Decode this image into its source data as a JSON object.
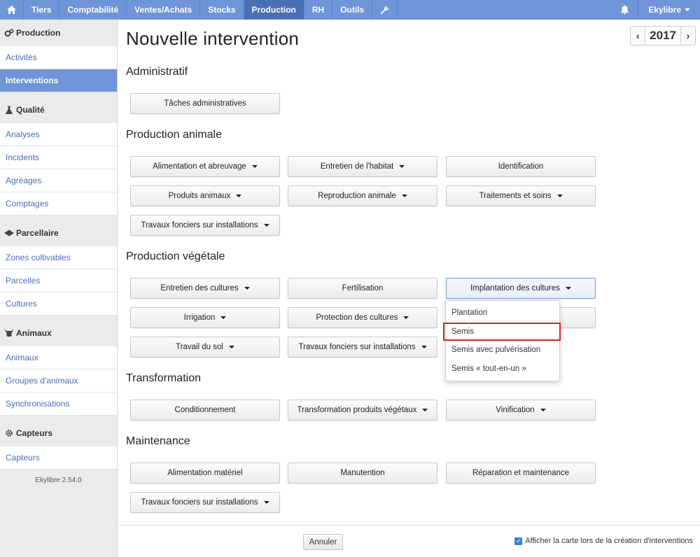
{
  "topbar": {
    "home_icon": "home-icon",
    "items": [
      {
        "label": "Tiers"
      },
      {
        "label": "Comptabilité"
      },
      {
        "label": "Ventes/Achats"
      },
      {
        "label": "Stocks"
      },
      {
        "label": "Production"
      },
      {
        "label": "RH"
      },
      {
        "label": "Outils"
      }
    ],
    "settings_icon": "wrench-icon",
    "notification_icon": "bell-icon",
    "user": "Ekylibre",
    "accent": "#6f94d8",
    "active_accent": "#4a6fb5"
  },
  "sidebar": {
    "sections": [
      {
        "title": "Production",
        "icon": "gears-icon",
        "items": [
          "Activités",
          "Interventions"
        ]
      },
      {
        "title": "Qualité",
        "icon": "flask-icon",
        "items": [
          "Analyses",
          "Incidents",
          "Agréages",
          "Comptages"
        ]
      },
      {
        "title": "Parcellaire",
        "icon": "map-icon",
        "items": [
          "Zones cultivables",
          "Parcelles",
          "Cultures"
        ]
      },
      {
        "title": "Animaux",
        "icon": "cow-icon",
        "items": [
          "Animaux",
          "Groupes d'animaux",
          "Synchronisations"
        ]
      },
      {
        "title": "Capteurs",
        "icon": "gear-icon",
        "items": [
          "Capteurs"
        ]
      }
    ],
    "active_item": "Interventions",
    "version": "Ekylibre 2.54.0"
  },
  "page": {
    "title": "Nouvelle intervention",
    "year": "2017",
    "prev_label": "‹",
    "next_label": "›"
  },
  "sections": {
    "administratif": {
      "title": "Administratif",
      "buttons": [
        "Tâches administratives"
      ]
    },
    "animale": {
      "title": "Production animale",
      "buttons": [
        "Alimentation et abreuvage",
        "Entretien de l'habitat",
        "Identification",
        "Produits animaux",
        "Reproduction animale",
        "Traitements et soins",
        "Travaux fonciers sur installations"
      ]
    },
    "vegetale": {
      "title": "Production végétale",
      "buttons": [
        "Entretien des cultures",
        "Fertilisation",
        "Implantation des cultures",
        "Irrigation",
        "Protection des cultures",
        "",
        "Travail du sol",
        "Travaux fonciers sur installations"
      ]
    },
    "transformation": {
      "title": "Transformation",
      "buttons": [
        "Conditionnement",
        "Transformation produits végétaux",
        "Vinification"
      ]
    },
    "maintenance": {
      "title": "Maintenance",
      "buttons": [
        "Alimentation matériel",
        "Manutention",
        "Réparation et maintenance",
        "Travaux fonciers sur installations"
      ]
    }
  },
  "dropdown": {
    "items": [
      "Plantation",
      "Semis",
      "Semis avec pulvérisation",
      "Semis « tout-en-un »"
    ],
    "highlighted": "Semis",
    "highlight_color": "#dd2222"
  },
  "footer": {
    "cancel_label": "Annuler",
    "map_option_label": "Afficher la carte lors de la création d'interventions",
    "map_option_checked": true
  }
}
